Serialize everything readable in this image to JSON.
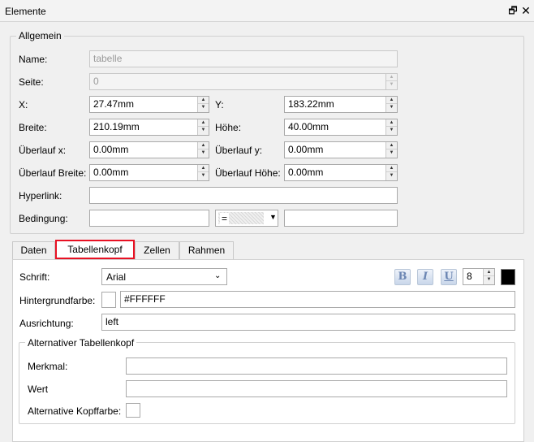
{
  "window": {
    "title": "Elemente",
    "restore_icon": "restore-window-icon",
    "close_icon": "close-icon"
  },
  "allgemein": {
    "legend": "Allgemein",
    "name_label": "Name:",
    "name_value": "tabelle",
    "seite_label": "Seite:",
    "seite_value": "0",
    "x_label": "X:",
    "x_value": "27.47mm",
    "y_label": "Y:",
    "y_value": "183.22mm",
    "breite_label": "Breite:",
    "breite_value": "210.19mm",
    "hoehe_label": "Höhe:",
    "hoehe_value": "40.00mm",
    "ueberlauf_x_label": "Überlauf x:",
    "ueberlauf_x_value": "0.00mm",
    "ueberlauf_y_label": "Überlauf y:",
    "ueberlauf_y_value": "0.00mm",
    "ueberlauf_breite_label": "Überlauf Breite:",
    "ueberlauf_breite_value": "0.00mm",
    "ueberlauf_hoehe_label": "Überlauf Höhe:",
    "ueberlauf_hoehe_value": "0.00mm",
    "hyperlink_label": "Hyperlink:",
    "hyperlink_value": "",
    "bedingung_label": "Bedingung:",
    "bedingung_left": "",
    "bedingung_op": "=",
    "bedingung_right": ""
  },
  "tabs": [
    {
      "label": "Daten",
      "active": false
    },
    {
      "label": "Tabellenkopf",
      "active": true
    },
    {
      "label": "Zellen",
      "active": false
    },
    {
      "label": "Rahmen",
      "active": false
    }
  ],
  "tabellenkopf": {
    "schrift_label": "Schrift:",
    "schrift_value": "Arial",
    "bold_label": "B",
    "italic_label": "I",
    "underline_label": "U",
    "font_size": "8",
    "font_color": "#000000",
    "hintergrund_label": "Hintergrundfarbe:",
    "hintergrund_value": "#FFFFFF",
    "hintergrund_color": "#FFFFFF",
    "ausrichtung_label": "Ausrichtung:",
    "ausrichtung_value": "left",
    "alt": {
      "legend": "Alternativer Tabellenkopf",
      "merkmal_label": "Merkmal:",
      "merkmal_value": "",
      "wert_label": "Wert",
      "wert_value": "",
      "kopffarbe_label": "Alternative Kopffarbe:",
      "kopffarbe_color": "#FFFFFF"
    }
  }
}
